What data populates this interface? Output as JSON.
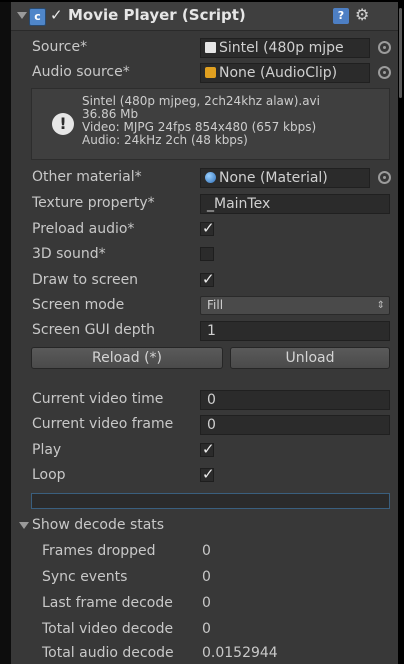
{
  "header": {
    "title": "Movie Player (Script)",
    "enabled": true
  },
  "fields": {
    "source": {
      "label": "Source*",
      "value": "Sintel (480p mjpe"
    },
    "audio_source": {
      "label": "Audio source*",
      "value": "None (AudioClip)"
    },
    "info": {
      "lines": [
        "Sintel (480p mjpeg, 2ch24khz alaw).avi",
        "36.86 Mb",
        "Video: MJPG 24fps 854x480 (657 kbps)",
        "Audio:  24kHz 2ch (48 kbps)"
      ]
    },
    "other_material": {
      "label": "Other material*",
      "value": "None (Material)"
    },
    "texture_property": {
      "label": "Texture property*",
      "value": "_MainTex"
    },
    "preload_audio": {
      "label": "Preload audio*",
      "checked": true
    },
    "sound_3d": {
      "label": "3D sound*",
      "checked": false
    },
    "draw_to_screen": {
      "label": "Draw to screen",
      "checked": true
    },
    "screen_mode": {
      "label": "Screen mode",
      "value": "Fill"
    },
    "screen_gui_depth": {
      "label": "Screen GUI depth",
      "value": "1"
    },
    "current_video_time": {
      "label": "Current video time",
      "value": "0"
    },
    "current_video_frame": {
      "label": "Current video frame",
      "value": "0"
    },
    "play": {
      "label": "Play",
      "checked": true
    },
    "loop": {
      "label": "Loop",
      "checked": true
    }
  },
  "buttons": {
    "reload": "Reload (*)",
    "unload": "Unload"
  },
  "decode_stats": {
    "title": "Show decode stats",
    "rows": [
      {
        "label": "Frames dropped",
        "value": "0"
      },
      {
        "label": "Sync events",
        "value": "0"
      },
      {
        "label": "Last frame decode",
        "value": "0"
      },
      {
        "label": "Total video decode",
        "value": "0"
      },
      {
        "label": "Total audio decode",
        "value": "0.0152944"
      }
    ]
  },
  "progress": {
    "fraction": 0
  },
  "icons": {
    "script": "script-icon",
    "help": "help-icon",
    "settings": "gear-icon",
    "source": "document-icon",
    "audio": "audio-clip-icon",
    "material": "material-icon",
    "info": "info-icon"
  },
  "colors": {
    "background": "#383838",
    "accent": "#3a5f7e"
  }
}
